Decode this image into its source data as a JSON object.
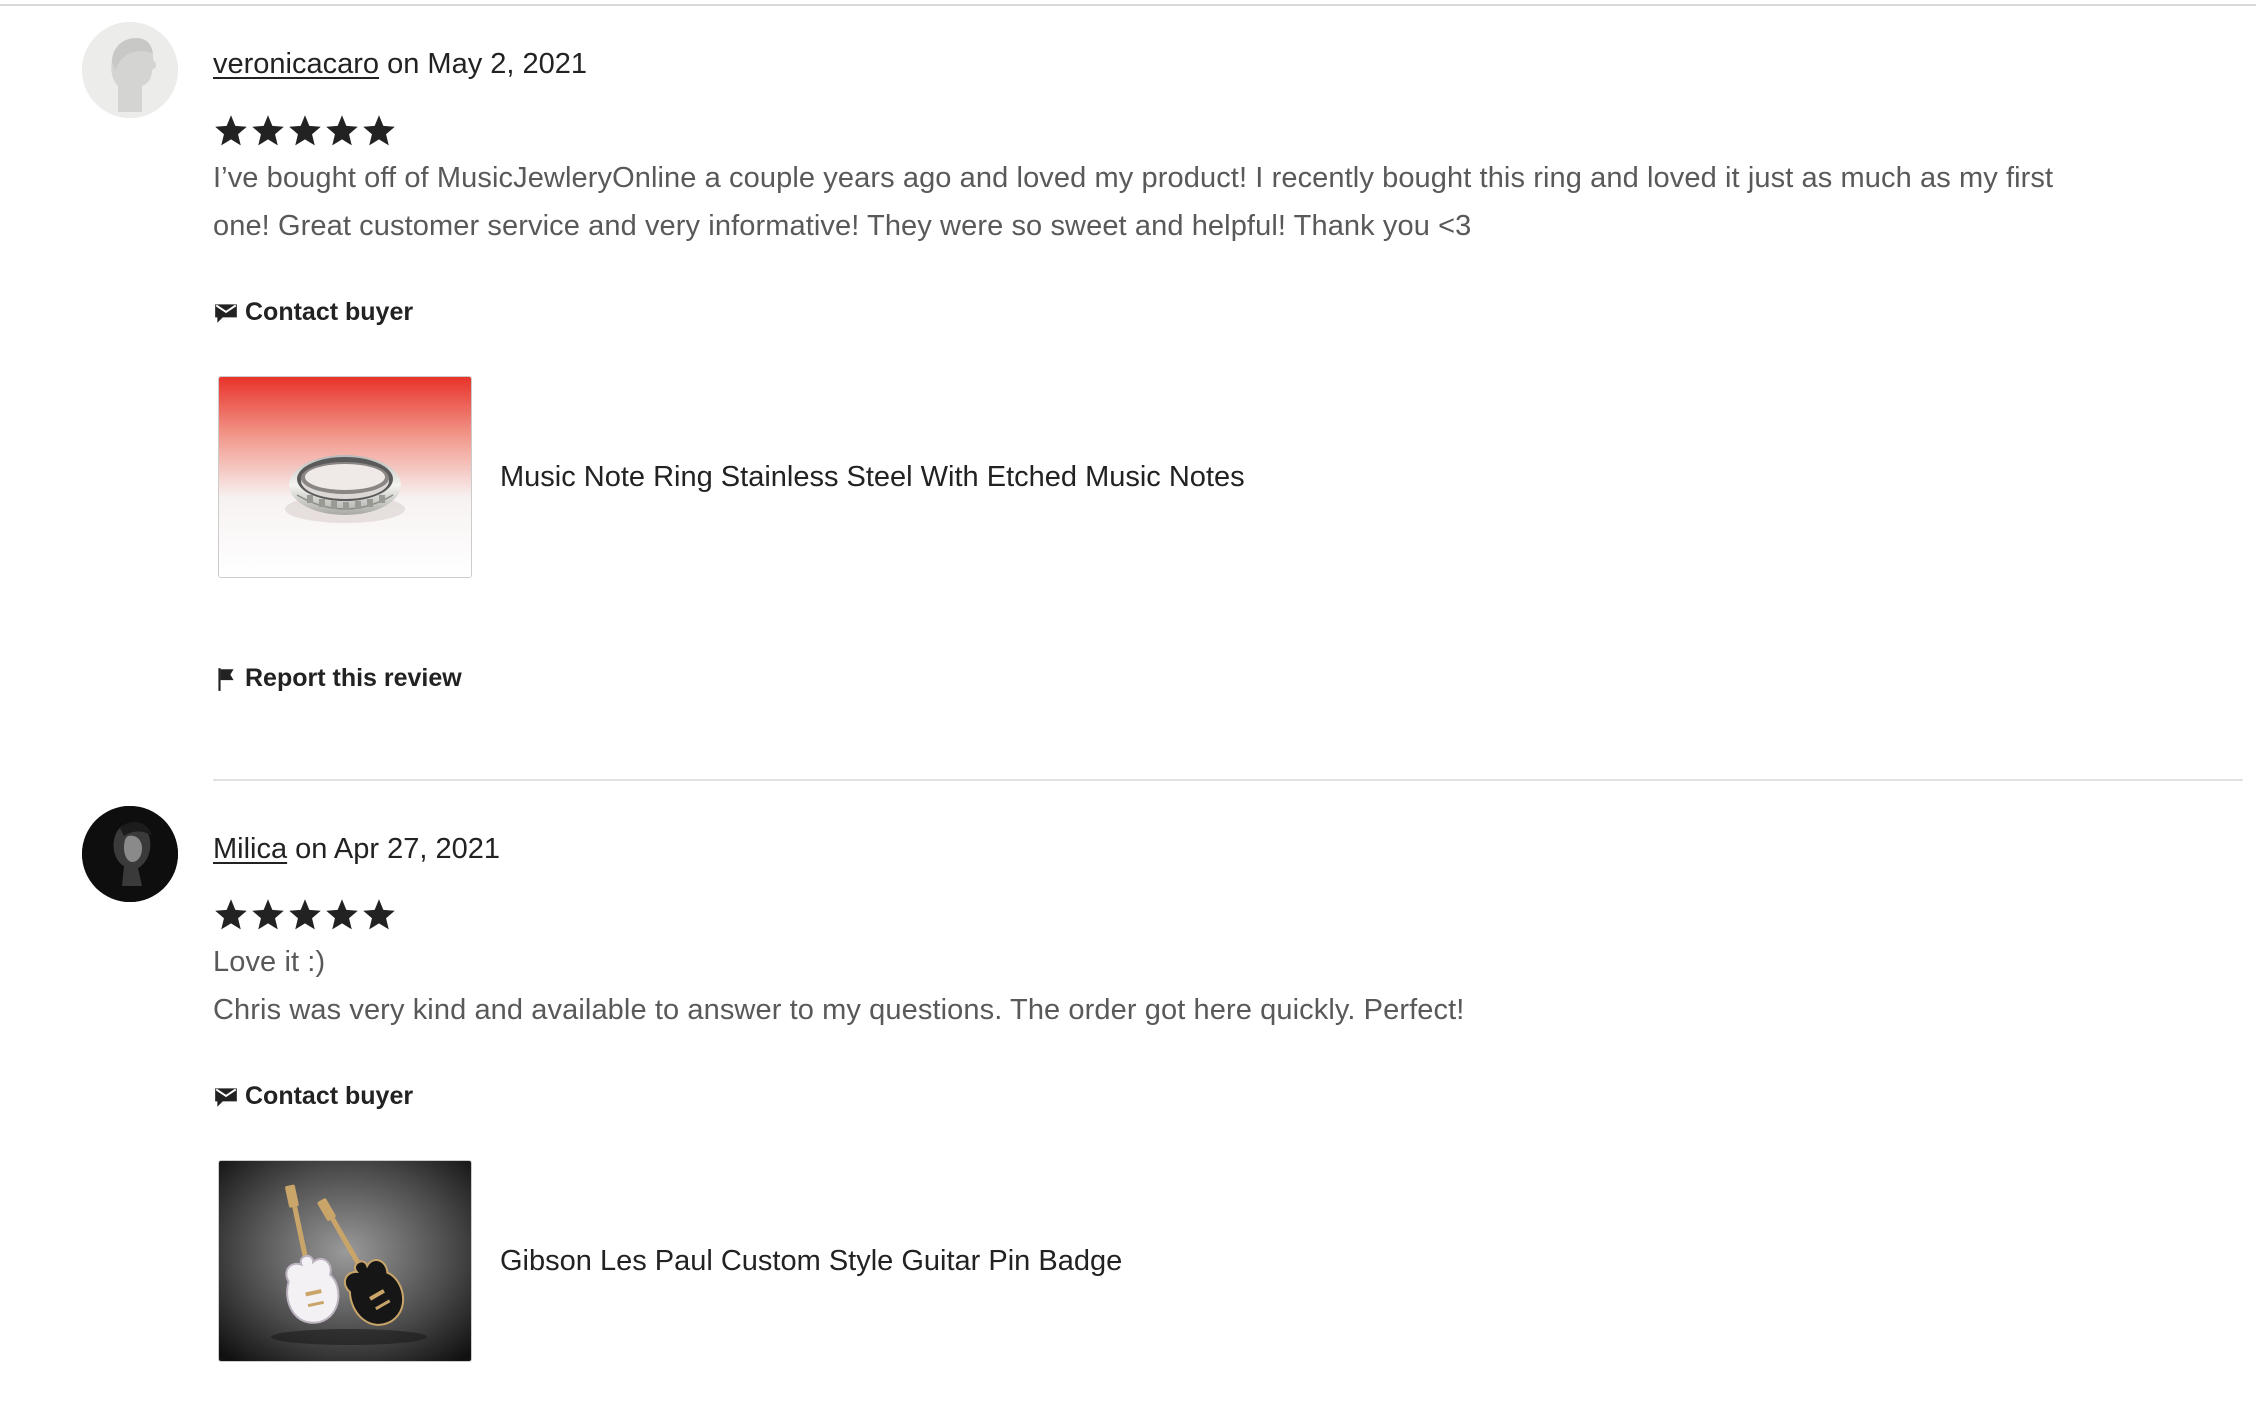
{
  "reviews": [
    {
      "username": "veronicacaro",
      "date_prefix": " on ",
      "date": "May 2, 2021",
      "rating": 5,
      "rating_max": 5,
      "title": "",
      "text": "I’ve bought off of MusicJewleryOnline a couple years ago and loved my product! I recently bought this ring and loved it just as much as my first one! Great customer service and very informative! They were so sweet and helpful! Thank you <3",
      "contact_label": "Contact buyer",
      "product_title": "Music Note Ring Stainless Steel With Etched Music Notes",
      "report_label": "Report this review"
    },
    {
      "username": "Milica",
      "date_prefix": " on ",
      "date": "Apr 27, 2021",
      "rating": 5,
      "rating_max": 5,
      "title": "Love it :)",
      "text": "Chris was very kind and available to answer to my questions. The order got here quickly. Perfect!",
      "contact_label": "Contact buyer",
      "product_title": "Gibson Les Paul Custom Style Guitar Pin Badge"
    }
  ],
  "icons": {
    "star": "star-icon",
    "contact": "envelope-icon",
    "report": "flag-icon"
  },
  "colors": {
    "text_primary": "#222222",
    "text_body": "#595959",
    "divider": "#e1e1e1",
    "star": "#222222"
  }
}
